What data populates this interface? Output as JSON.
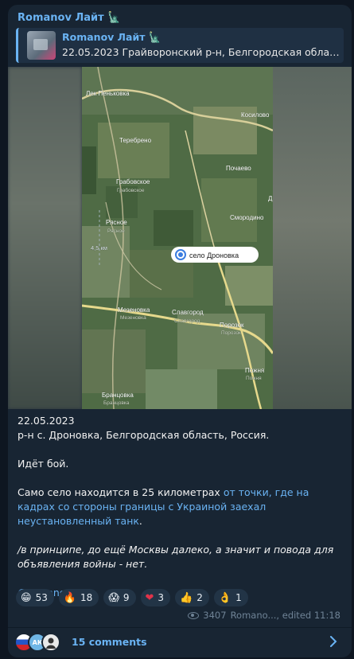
{
  "post": {
    "sender": "Romanov Лайт 🗽",
    "reply": {
      "name": "Romanov Лайт 🗽",
      "text": "22.05.2023 Грайворонский р-н, Белгородская область, ..."
    },
    "map": {
      "labels": {
        "penkovka": "Лек Пеньковка",
        "kosilovo": "Косилово",
        "tereбreno": "Теребрено",
        "pochaevo": "Почаево",
        "grabovskoe": "Грабовское",
        "grabovskoe_sub": "Грабовское",
        "smorodino": "Смородино",
        "rasnoe": "Рясное",
        "rasnoe_sub": "Рясное",
        "distance": "4,5 км",
        "pin": "село Дроновка",
        "mezenovka": "Мезеновка",
        "mezenovka_sub": "Мезеновка",
        "slavgorod": "Славгород",
        "slavgorod_sub": "Славгород",
        "porozok": "Порозок",
        "porozok_sub": "Порозок",
        "pozhnya": "Пожня",
        "pozhnya_sub": "Пожня",
        "brantsovka": "Бранцовка",
        "brantsovka_sub": "Бранцовка",
        "edge_d": "Д"
      }
    },
    "body": {
      "date": "22.05.2023",
      "location": "р-н с. Дроновка, Белгородская область, Россия.",
      "battle": "Идёт бой.",
      "p3_pre": "Само село находится в 25 километрах ",
      "p3_link": "от точки, где на кадрах со стороны границы с Украиной заехал неустановленный танк",
      "p3_post": ".",
      "italic": "/в принципе, до ещё Москвы далеко, а значит и повода для объявления войны - нет.",
      "handle": "@romanov_92"
    },
    "reactions": [
      {
        "emoji": "😁",
        "count": "53"
      },
      {
        "emoji": "🔥",
        "count": "18"
      },
      {
        "emoji": "😱",
        "count": "9"
      },
      {
        "emoji": "❤",
        "count": "3"
      },
      {
        "emoji": "👍",
        "count": "2"
      },
      {
        "emoji": "👌",
        "count": "1"
      }
    ],
    "meta": {
      "views": "3407",
      "author": "Romano..., edited 11:18"
    },
    "comments": {
      "label": "15 comments",
      "avatar2": "АК"
    }
  }
}
